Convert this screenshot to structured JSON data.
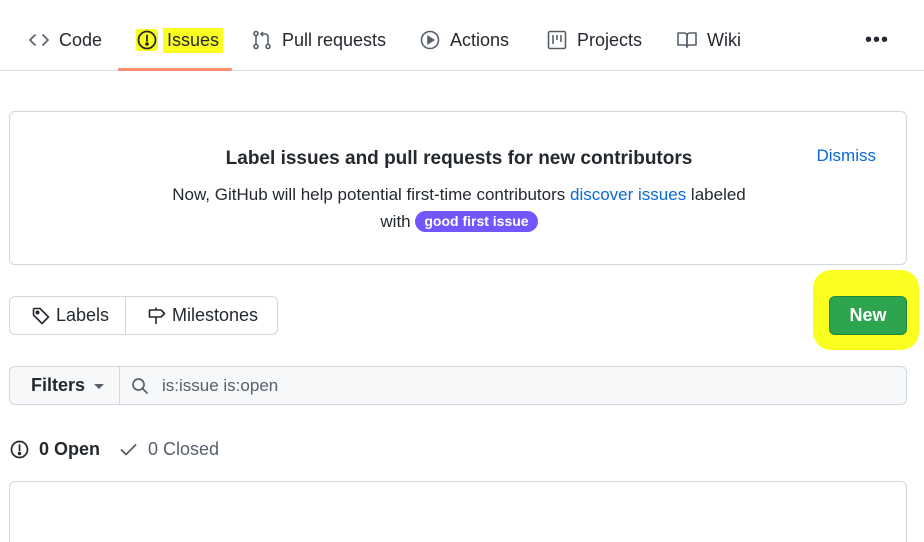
{
  "nav": {
    "tabs": [
      {
        "label": "Code",
        "icon": "code-icon"
      },
      {
        "label": "Issues",
        "icon": "issue-opened-icon",
        "selected": true
      },
      {
        "label": "Pull requests",
        "icon": "git-pull-request-icon"
      },
      {
        "label": "Actions",
        "icon": "play-icon"
      },
      {
        "label": "Projects",
        "icon": "project-icon"
      },
      {
        "label": "Wiki",
        "icon": "book-icon"
      }
    ],
    "more": "•••"
  },
  "banner": {
    "title": "Label issues and pull requests for new contributors",
    "text_before": "Now, GitHub will help potential first-time contributors ",
    "link": "discover issues",
    "text_after": " labeled",
    "text_with": "with",
    "label": "good first issue",
    "dismiss": "Dismiss"
  },
  "toolbar": {
    "labels": "Labels",
    "milestones": "Milestones",
    "new": "New"
  },
  "filters": {
    "button": "Filters",
    "query": "is:issue is:open"
  },
  "states": {
    "open": "0 Open",
    "closed": "0 Closed"
  },
  "colors": {
    "accent_link": "#0969da",
    "new_button": "#2da44e",
    "label_purple": "#7057ff",
    "highlight_yellow": "#fbff1f",
    "tab_underline": "#fd8c73"
  }
}
